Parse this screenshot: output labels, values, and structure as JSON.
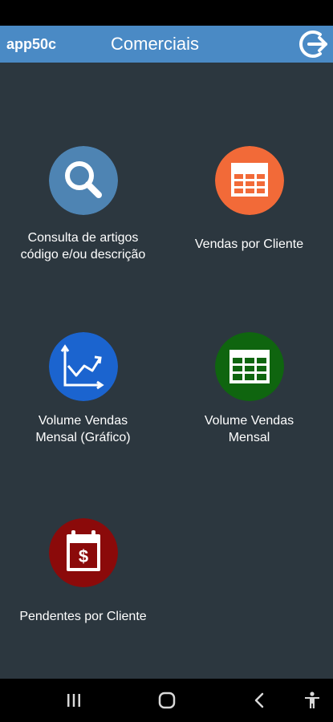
{
  "app_bar": {
    "app_code": "app50c",
    "title": "Comerciais",
    "logout_icon": "logout-arrow-icon",
    "color": "#4a8ac5"
  },
  "menu": {
    "items": [
      {
        "label": "Consulta de artigos\ncódigo e/ou descrição",
        "icon": "search-icon",
        "color": "#4e84b3"
      },
      {
        "label": "Vendas por Cliente",
        "icon": "table-icon",
        "color": "#f26a38"
      },
      {
        "label": "Volume Vendas\nMensal (Gráfico)",
        "icon": "line-chart-icon",
        "color": "#1b64cf"
      },
      {
        "label": "Volume Vendas\nMensal",
        "icon": "spreadsheet-icon",
        "color": "#0f650f"
      },
      {
        "label": "Pendentes por Cliente",
        "icon": "calendar-dollar-icon",
        "color": "#8b0a0a"
      }
    ]
  },
  "nav_bar": {
    "recents_icon": "recent-apps-icon",
    "home_icon": "home-icon",
    "back_icon": "back-icon",
    "accessibility_icon": "accessibility-icon"
  },
  "colors": {
    "background": "#2c373f",
    "status_bar": "#000000",
    "nav_bar": "#000000"
  }
}
